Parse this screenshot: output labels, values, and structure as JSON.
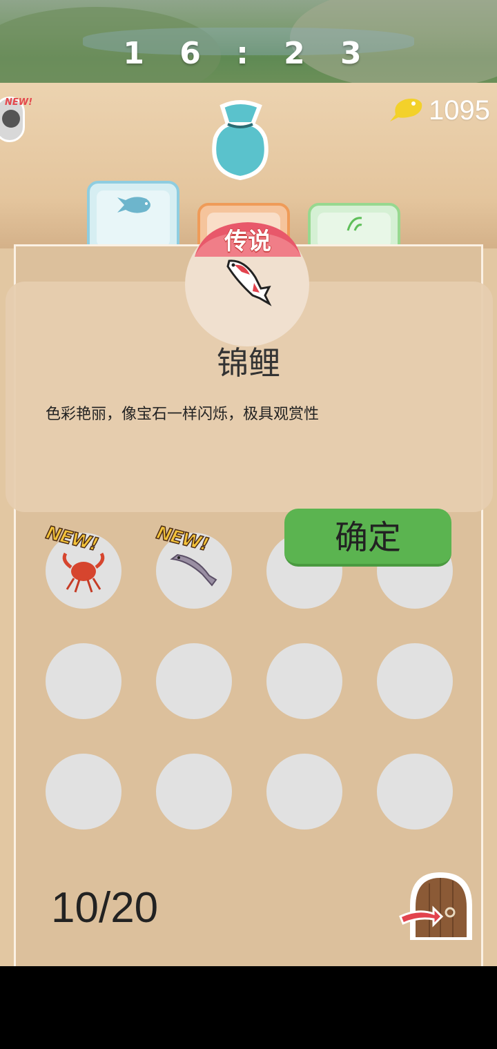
{
  "status": {
    "time": "1 6 : 2 3"
  },
  "header": {
    "avatar_badge": "NEW!",
    "coins": "1095"
  },
  "tabs": [
    {
      "name": "fish"
    },
    {
      "name": "legend"
    },
    {
      "name": "tool"
    }
  ],
  "popup": {
    "rarity": "传说",
    "fish_name": "锦鲤",
    "description": "色彩艳丽，像宝石一样闪烁，极具观赏性",
    "confirm_label": "确定"
  },
  "collection": {
    "badge_new": "NEW!",
    "counter": "10/20",
    "slots": [
      {
        "item": "crab",
        "new": true
      },
      {
        "item": "fish",
        "new": true
      },
      {
        "item": null
      },
      {
        "item": null
      },
      {
        "item": null
      },
      {
        "item": null
      },
      {
        "item": null
      },
      {
        "item": null
      },
      {
        "item": null
      },
      {
        "item": null
      },
      {
        "item": null
      },
      {
        "item": null
      }
    ]
  },
  "colors": {
    "board": "#e2c7a2",
    "confirm": "#5bb450",
    "legend_banner": "#e8586a"
  }
}
